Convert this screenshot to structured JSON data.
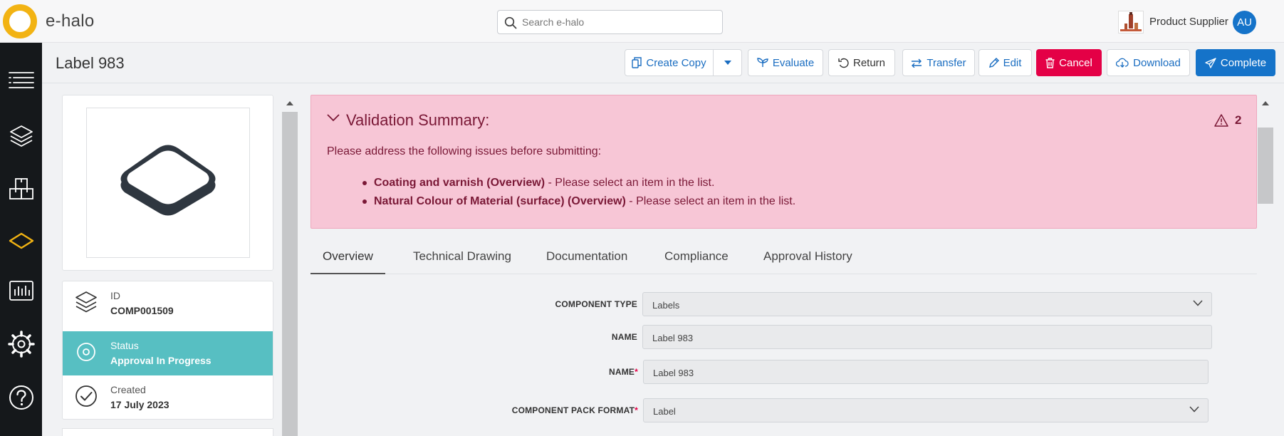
{
  "app": {
    "brand": "e-halo",
    "search_placeholder": "Search e-halo",
    "supplier": "Product Supplier",
    "avatar_initials": "AU",
    "colors": {
      "accent": "#1573c9",
      "danger": "#e40046",
      "logo": "#f2b313",
      "status": "#57bfc2"
    }
  },
  "sidebar": {
    "items": [
      {
        "icon": "menu-lines-icon"
      },
      {
        "icon": "layers-icon"
      },
      {
        "icon": "boxes-icon"
      },
      {
        "icon": "component-icon",
        "active": true
      },
      {
        "icon": "bar-chart-icon"
      },
      {
        "icon": "gear-icon"
      },
      {
        "icon": "help-icon"
      }
    ]
  },
  "header": {
    "title": "Label 983",
    "actions": {
      "create_copy": "Create Copy",
      "evaluate": "Evaluate",
      "return": "Return",
      "transfer": "Transfer",
      "edit": "Edit",
      "cancel": "Cancel",
      "download": "Download",
      "complete": "Complete"
    }
  },
  "details": {
    "id_label": "ID",
    "id_value": "COMP001509",
    "status_label": "Status",
    "status_value": "Approval In Progress",
    "created_label": "Created",
    "created_value": "17 July 2023"
  },
  "validation": {
    "title": "Validation Summary:",
    "count": "2",
    "intro": "Please address the following issues before submitting:",
    "issues": [
      {
        "field": "Coating and varnish (Overview)",
        "message": " - Please select an item in the list."
      },
      {
        "field": "Natural Colour of Material (surface) (Overview)",
        "message": " - Please select an item in the list."
      }
    ]
  },
  "tabs": [
    "Overview",
    "Technical Drawing",
    "Documentation",
    "Compliance",
    "Approval History"
  ],
  "form": {
    "component_type_label": "COMPONENT TYPE",
    "component_type_value": "Labels",
    "name_label": "NAME",
    "name_value": "Label 983",
    "name2_label": "NAME",
    "name2_value": "Label 983",
    "pack_format_label": "COMPONENT PACK FORMAT",
    "pack_format_value": "Label",
    "required_mark": "*"
  }
}
